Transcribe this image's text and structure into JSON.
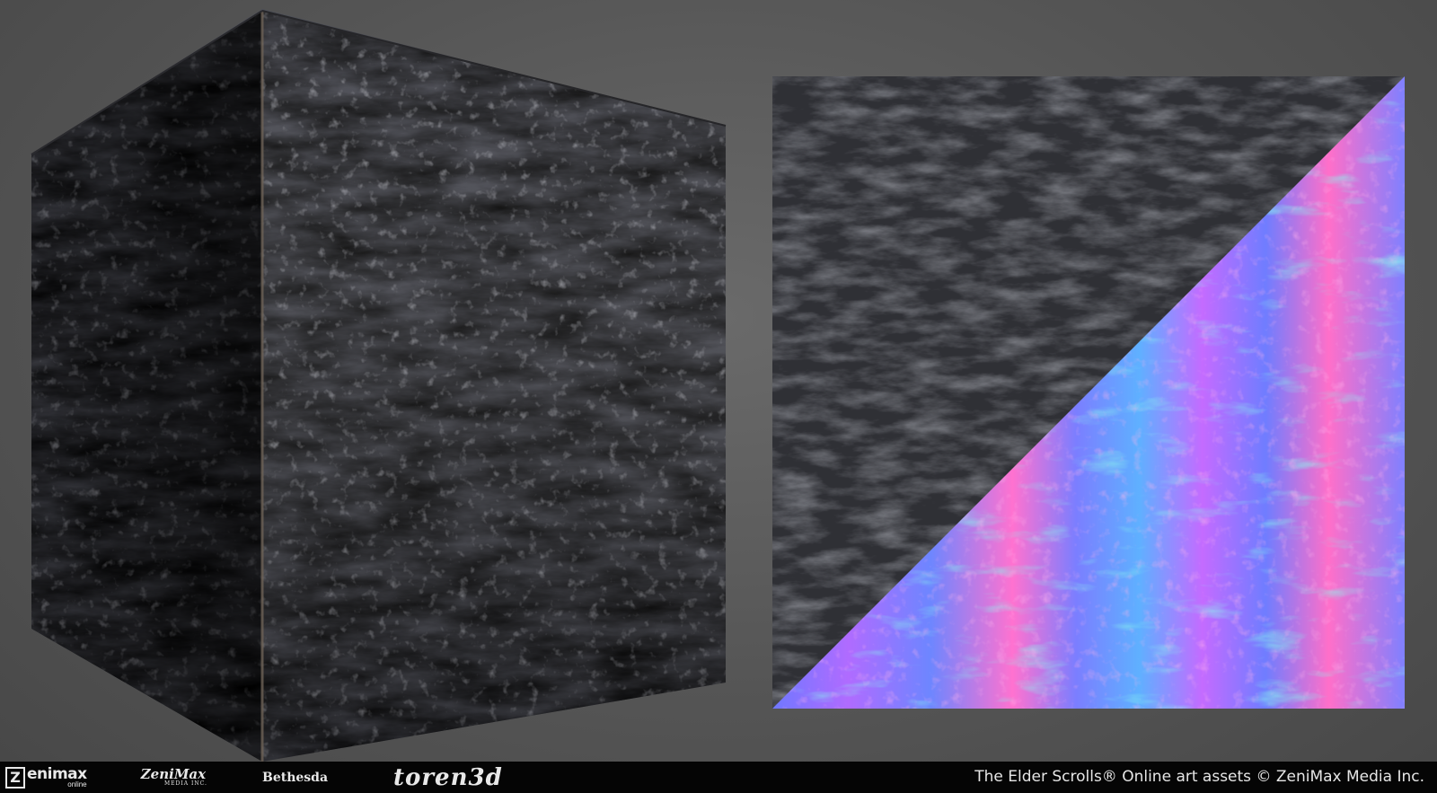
{
  "render": {
    "cube_colors": {
      "light": "#5b5d66",
      "mid": "#3e3f47",
      "dark": "#24252b",
      "edge": "#6e6358"
    },
    "swatch_colors": {
      "albedo": "#2f3035",
      "albedo_light": "#45474d",
      "normal_blue": "#7f80ff",
      "normal_pink": "#ff6fc9",
      "normal_cyan": "#3fe0d8"
    }
  },
  "footer": {
    "logos": {
      "zenimax_online_mark": "Z",
      "zenimax_online_word": "enimax",
      "zenimax_online_sub": "online",
      "zenimax_media_word": "ZeniMax",
      "zenimax_media_sub": "MEDIA INC.",
      "bethesda": "Bethesda",
      "toren3d": "toren3d"
    },
    "copyright": "The Elder Scrolls® Online art assets © ZeniMax Media Inc."
  }
}
